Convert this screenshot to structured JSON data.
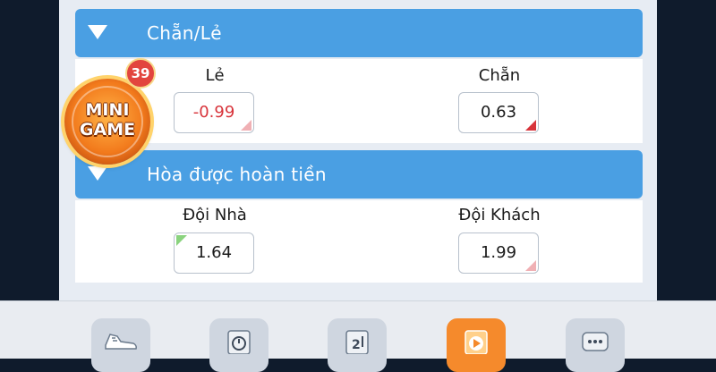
{
  "sections": [
    {
      "title": "Chẵn/Lẻ",
      "left": {
        "label": "Lẻ",
        "odds": "-0.99"
      },
      "right": {
        "label": "Chẵn",
        "odds": "0.63"
      }
    },
    {
      "title": "Hòa được hoàn tiền",
      "left": {
        "label": "Đội Nhà",
        "odds": "1.64"
      },
      "right": {
        "label": "Đội Khách",
        "odds": "1.99"
      }
    }
  ],
  "mini_game": {
    "line1": "MINI",
    "line2": "GAME",
    "badge": "39"
  },
  "bottom_nav": [
    {
      "icon": "sneaker-icon",
      "active": false
    },
    {
      "icon": "timer-icon",
      "active": false
    },
    {
      "icon": "scoreboard-icon",
      "active": false
    },
    {
      "icon": "play-video-icon",
      "active": true
    },
    {
      "icon": "chat-bubble-icon",
      "active": false
    }
  ],
  "colors": {
    "header": "#4a9fe3",
    "negative": "#d8343b",
    "up": "#8ad37e",
    "active_tab": "#f58a2c"
  }
}
